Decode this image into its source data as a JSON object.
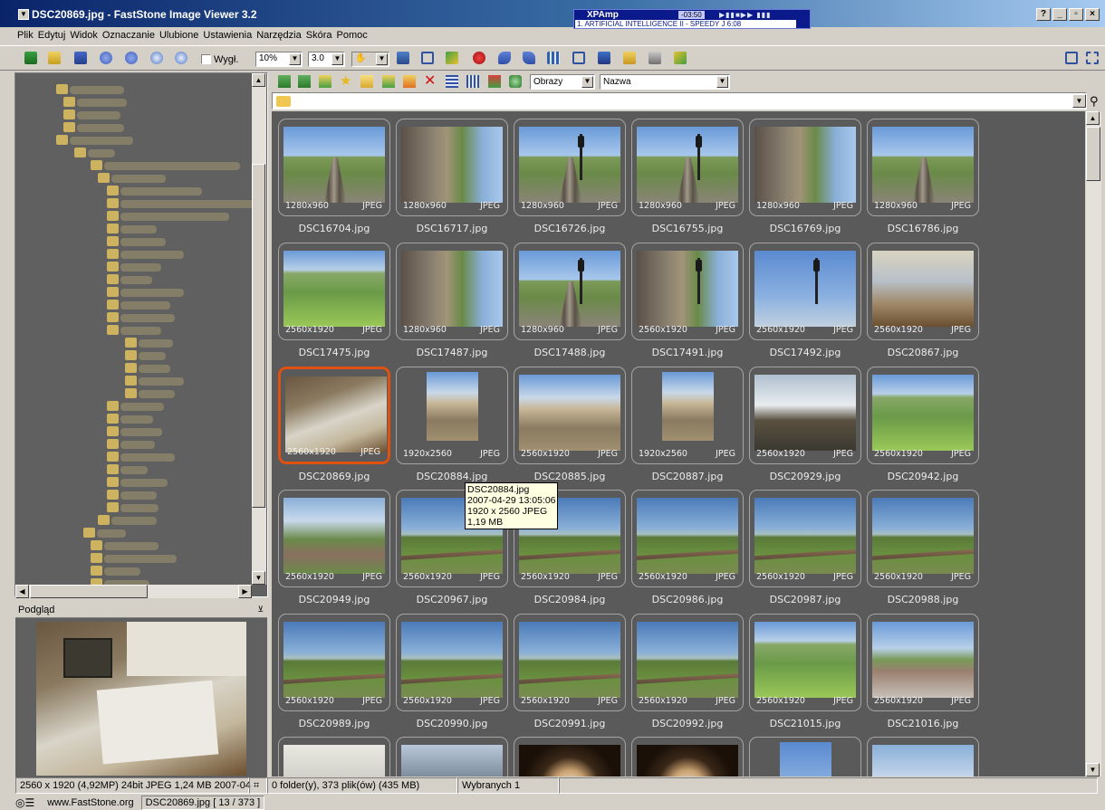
{
  "window": {
    "title": "DSC20869.jpg  -  FastStone Image Viewer 3.2",
    "btn_help": "?",
    "btn_minimize": "_",
    "btn_maximize": "▫",
    "btn_close": "×"
  },
  "xpamp": {
    "title": "XPAmp",
    "time": "-03:50",
    "song": "1. ARTIFICIAL INTELLIGENCE II - SPEEDY J 6:08"
  },
  "menu": [
    "Plik",
    "Edytuj",
    "Widok",
    "Oznaczanie",
    "Ulubione",
    "Ustawienia",
    "Narzędzia",
    "Skóra",
    "Pomoc"
  ],
  "toolbar": {
    "fit_label": "Wygł.",
    "zoom": "10%",
    "gamma": "3.0"
  },
  "browser": {
    "filter": "Obrazy",
    "sort": "Nazwa"
  },
  "preview": {
    "label": "Podgląd"
  },
  "status": {
    "image_info": "2560 x 1920 (4,92MP)  24bit JPEG  1,24 MB  2007-04",
    "folder_info": "0 folder(y), 373 plik(ów) (435 MB)",
    "selected": "Wybranych 1",
    "site": "www.FastStone.org",
    "current": "DSC20869.jpg [ 13 / 373 ]"
  },
  "tooltip": {
    "name": "DSC20884.jpg",
    "date": "2007-04-29 13:05:06",
    "dims": "1920 x 2560  JPEG",
    "size": "1,19 MB"
  },
  "thumbs": [
    {
      "name": "DSC16704.jpg",
      "dims": "1280x960",
      "fmt": "JPEG"
    },
    {
      "name": "DSC16717.jpg",
      "dims": "1280x960",
      "fmt": "JPEG"
    },
    {
      "name": "DSC16726.jpg",
      "dims": "1280x960",
      "fmt": "JPEG"
    },
    {
      "name": "DSC16755.jpg",
      "dims": "1280x960",
      "fmt": "JPEG"
    },
    {
      "name": "DSC16769.jpg",
      "dims": "1280x960",
      "fmt": "JPEG"
    },
    {
      "name": "DSC16786.jpg",
      "dims": "1280x960",
      "fmt": "JPEG"
    },
    {
      "name": "DSC17475.jpg",
      "dims": "2560x1920",
      "fmt": "JPEG"
    },
    {
      "name": "DSC17487.jpg",
      "dims": "1280x960",
      "fmt": "JPEG"
    },
    {
      "name": "DSC17488.jpg",
      "dims": "1280x960",
      "fmt": "JPEG"
    },
    {
      "name": "DSC17491.jpg",
      "dims": "2560x1920",
      "fmt": "JPEG"
    },
    {
      "name": "DSC17492.jpg",
      "dims": "2560x1920",
      "fmt": "JPEG"
    },
    {
      "name": "DSC20867.jpg",
      "dims": "2560x1920",
      "fmt": "JPEG"
    },
    {
      "name": "DSC20869.jpg",
      "dims": "2560x1920",
      "fmt": "JPEG"
    },
    {
      "name": "DSC20884.jpg",
      "dims": "1920x2560",
      "fmt": "JPEG"
    },
    {
      "name": "DSC20885.jpg",
      "dims": "2560x1920",
      "fmt": "JPEG"
    },
    {
      "name": "DSC20887.jpg",
      "dims": "1920x2560",
      "fmt": "JPEG"
    },
    {
      "name": "DSC20929.jpg",
      "dims": "2560x1920",
      "fmt": "JPEG"
    },
    {
      "name": "DSC20942.jpg",
      "dims": "2560x1920",
      "fmt": "JPEG"
    },
    {
      "name": "DSC20949.jpg",
      "dims": "2560x1920",
      "fmt": "JPEG"
    },
    {
      "name": "DSC20967.jpg",
      "dims": "2560x1920",
      "fmt": "JPEG"
    },
    {
      "name": "DSC20984.jpg",
      "dims": "2560x1920",
      "fmt": "JPEG"
    },
    {
      "name": "DSC20986.jpg",
      "dims": "2560x1920",
      "fmt": "JPEG"
    },
    {
      "name": "DSC20987.jpg",
      "dims": "2560x1920",
      "fmt": "JPEG"
    },
    {
      "name": "DSC20988.jpg",
      "dims": "2560x1920",
      "fmt": "JPEG"
    },
    {
      "name": "DSC20989.jpg",
      "dims": "2560x1920",
      "fmt": "JPEG"
    },
    {
      "name": "DSC20990.jpg",
      "dims": "2560x1920",
      "fmt": "JPEG"
    },
    {
      "name": "DSC20991.jpg",
      "dims": "2560x1920",
      "fmt": "JPEG"
    },
    {
      "name": "DSC20992.jpg",
      "dims": "2560x1920",
      "fmt": "JPEG"
    },
    {
      "name": "DSC21015.jpg",
      "dims": "2560x1920",
      "fmt": "JPEG"
    },
    {
      "name": "DSC21016.jpg",
      "dims": "2560x1920",
      "fmt": "JPEG"
    },
    {
      "name": "",
      "dims": "",
      "fmt": ""
    },
    {
      "name": "",
      "dims": "",
      "fmt": ""
    },
    {
      "name": "",
      "dims": "",
      "fmt": ""
    },
    {
      "name": "",
      "dims": "",
      "fmt": ""
    },
    {
      "name": "",
      "dims": "",
      "fmt": ""
    },
    {
      "name": "",
      "dims": "",
      "fmt": ""
    }
  ],
  "selected_index": 12
}
